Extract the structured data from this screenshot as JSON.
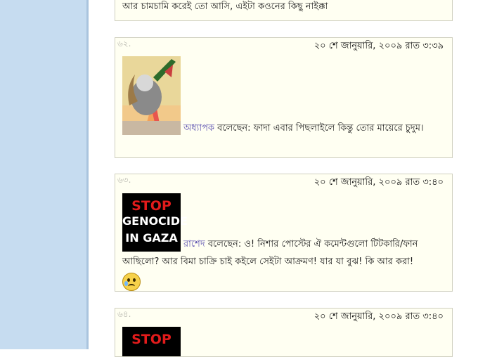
{
  "comments": [
    {
      "number": "",
      "date": "",
      "author": "",
      "says": "",
      "text": "আর চামচামি করেই তো আসি, এইটা কওনের কিছু নাইক্কা"
    },
    {
      "number": "৬২.",
      "date": "২০ শে জানুয়ারি, ২০০৯ রাত ৩:৩৯",
      "author": "অধ্যাপক",
      "says": "বলেছেন:",
      "text": "ফাদা এবার পিছলাইলে কিন্তু তোর মায়েরে চুদুম।"
    },
    {
      "number": "৬৩.",
      "date": "২০ শে জানুয়ারি, ২০০৯ রাত ৩:৪০",
      "author": "রাশেদ",
      "says": "বলেছেন:",
      "text": "ও! নিশার পোস্টের ঐ কমেন্টগুলো টিটকারি/ফান আছিলো? আর বিমা চাক্রি চাই কইলে সেইটা আক্রমণ! যার যা বুঝ! কি আর করা!"
    },
    {
      "number": "৬৪.",
      "date": "২০ শে জানুয়ারি, ২০০৯ রাত ৩:৪০",
      "author": "",
      "says": "",
      "text": ""
    }
  ],
  "stop_image": {
    "line1": "STOP",
    "line2": "GENOCIDE",
    "line3": "IN GAZA"
  },
  "stop_image_partial": {
    "line1": "STOP"
  },
  "emoticon": "crying-face",
  "colors": {
    "left_panel": "#c6dcf0",
    "comment_bg": "#fffff2",
    "author_link": "#5a4fb0",
    "stop_red": "#e21b1b"
  }
}
